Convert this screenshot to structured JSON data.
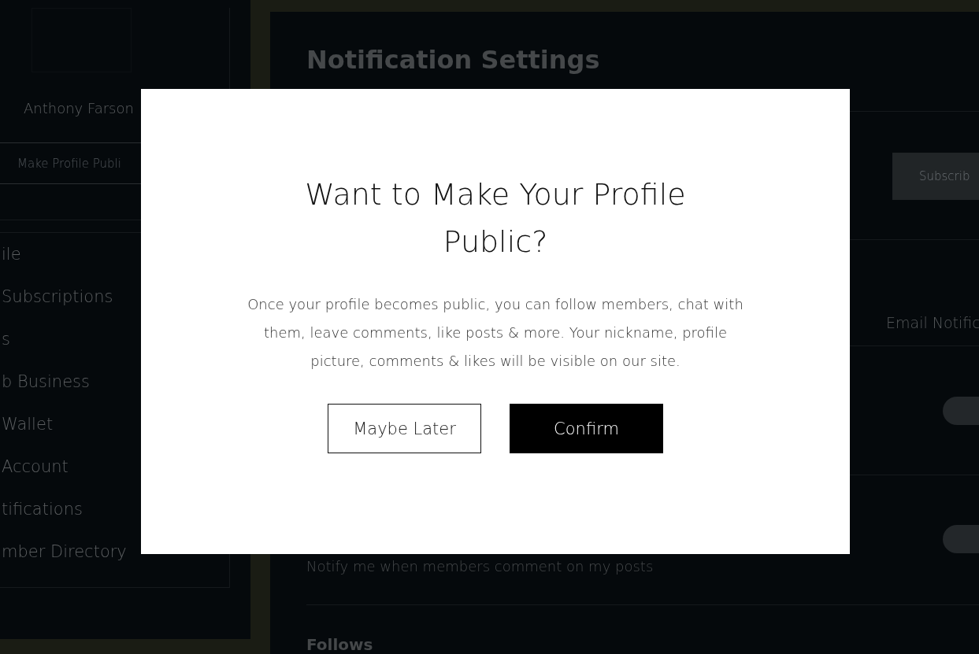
{
  "sidebar": {
    "member_name": "Anthony Farson",
    "profile_button": "Make Profile Publi",
    "items": [
      {
        "label": "ile"
      },
      {
        "label": "Subscriptions"
      },
      {
        "label": "s"
      },
      {
        "label": "b Business"
      },
      {
        "label": "Wallet"
      },
      {
        "label": "Account"
      },
      {
        "label": "tifications"
      },
      {
        "label": "mber Directory"
      }
    ]
  },
  "main": {
    "title": "Notification Settings",
    "subscribe_button": "Subscrib",
    "column_header": "Email Notific",
    "toggles": [
      {
        "on": false
      },
      {
        "on": false
      }
    ],
    "setting_description": "Notify me when members comment on my posts",
    "section_heading": "Follows"
  },
  "dialog": {
    "title": "Want to Make Your Profile Public?",
    "body": "Once your profile becomes public, you can follow members, chat with them, leave comments, like posts & more. Your nickname, profile picture, comments & likes will be visible on our site.",
    "buttons": [
      {
        "label": "Maybe Later",
        "kind": "secondary"
      },
      {
        "label": "Confirm",
        "kind": "primary"
      }
    ]
  }
}
